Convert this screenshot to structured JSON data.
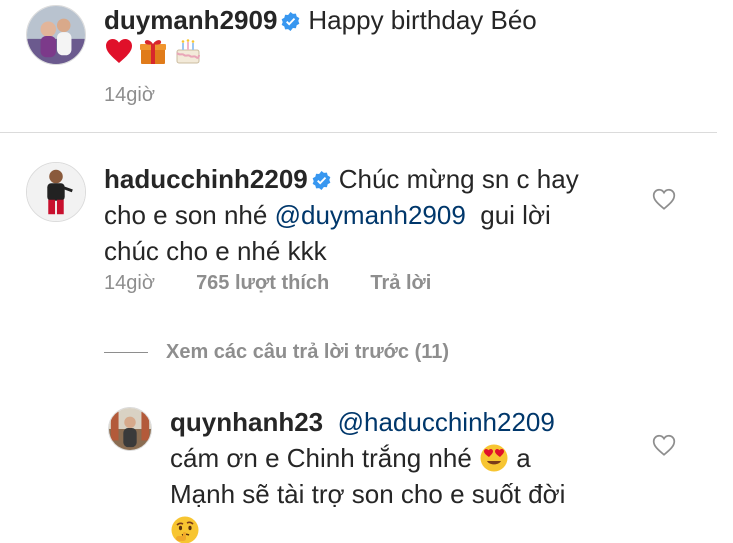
{
  "post": {
    "username": "duymanh2909",
    "caption": "Happy birthday Béo",
    "emojis": [
      "red-heart",
      "gift",
      "birthday-cake"
    ],
    "time": "14giờ"
  },
  "comment": {
    "username": "haducchinh2209",
    "text_before_mention": "Chúc mừng sn c hay",
    "text_line2_prefix": "cho e son nhé",
    "mention": "@duymanh2909",
    "text_after_mention": "gui lời",
    "text_line3": "chúc cho e nhé kkk",
    "time": "14giờ",
    "likes": "765 lượt thích",
    "reply_label": "Trả lời"
  },
  "view_replies": {
    "label": "Xem các câu trả lời trước (11)"
  },
  "reply": {
    "username": "quynhanh23",
    "mention": "@haducchinh2209",
    "line2": "cám ơn e Chinh trắng nhé",
    "line2_suffix": "a",
    "line3": "Mạnh sẽ tài trợ son cho e suốt đời"
  },
  "colors": {
    "verified_blue": "#3897f0",
    "mention_blue": "#00376b",
    "muted_gray": "#8e8e8e"
  }
}
